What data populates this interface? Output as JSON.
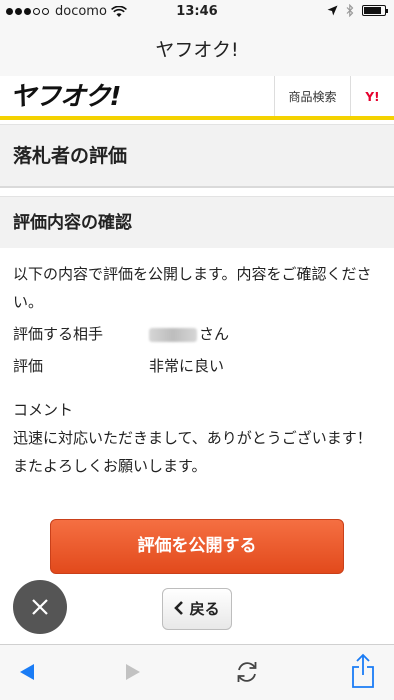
{
  "status_bar": {
    "carrier": "docomo",
    "time": "13:46",
    "signal_bars": 3,
    "battery_level": 0.85
  },
  "safari": {
    "page_title": "ヤフオク!"
  },
  "site_header": {
    "logo": "ヤフオク!",
    "search_link": "商品検索",
    "yahoo_link": "Y!"
  },
  "page": {
    "title": "落札者の評価",
    "section_heading": "評価内容の確認",
    "intro": "以下の内容で評価を公開します。内容をご確認ください。",
    "rows": [
      {
        "label": "評価する相手",
        "value": "さん"
      },
      {
        "label": "評価",
        "value": "非常に良い"
      }
    ],
    "comment_label": "コメント",
    "comment_text": "迅速に対応いただきまして、ありがとうございます！またよろしくお願いします。"
  },
  "buttons": {
    "publish": "評価を公開する",
    "back": "戻る"
  },
  "colors": {
    "accent": "#e24a1c",
    "header_underline": "#f4d200",
    "ios_blue": "#1a7cf5"
  },
  "icons": {
    "close": "close-icon",
    "back_chevron": "chevron-left-icon",
    "toolbar": [
      "back-arrow-icon",
      "forward-arrow-icon",
      "reload-icon",
      "share-icon"
    ]
  }
}
